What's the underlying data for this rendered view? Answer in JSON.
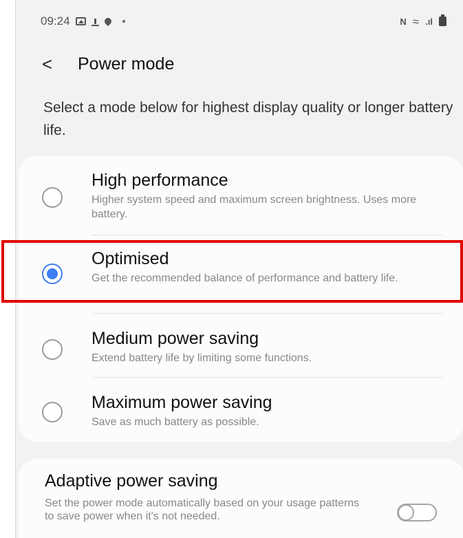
{
  "status_bar": {
    "time": "09:24",
    "left_icons": [
      "gallery-icon",
      "upload-icon",
      "location-pin-icon",
      "dot-icon"
    ],
    "right_icons": [
      "nfc-icon",
      "wifi-icon",
      "signal-icon",
      "battery-icon"
    ],
    "nfc_glyph": "N",
    "wifi_glyph": "≈",
    "signal_glyph": ".ıl"
  },
  "header": {
    "back_glyph": "<",
    "title": "Power mode"
  },
  "description": "Select a mode below for highest display quality or longer battery life.",
  "modes": [
    {
      "title": "High performance",
      "description": "Higher system speed and maximum screen brightness. Uses more battery.",
      "selected": false
    },
    {
      "title": "Optimised",
      "description": "Get the recommended balance of performance and battery life.",
      "selected": true
    },
    {
      "title": "Medium power saving",
      "description": "Extend battery life by limiting some functions.",
      "selected": false
    },
    {
      "title": "Maximum power saving",
      "description": "Save as much battery as possible.",
      "selected": false
    }
  ],
  "adaptive": {
    "title": "Adaptive power saving",
    "description": "Set the power mode automatically based on your usage patterns to save power when it's not needed.",
    "enabled": false
  },
  "colors": {
    "accent": "#3e7ef1",
    "highlight_border": "#e10000",
    "background": "#f2f2f2",
    "card": "#fcfcfc"
  }
}
